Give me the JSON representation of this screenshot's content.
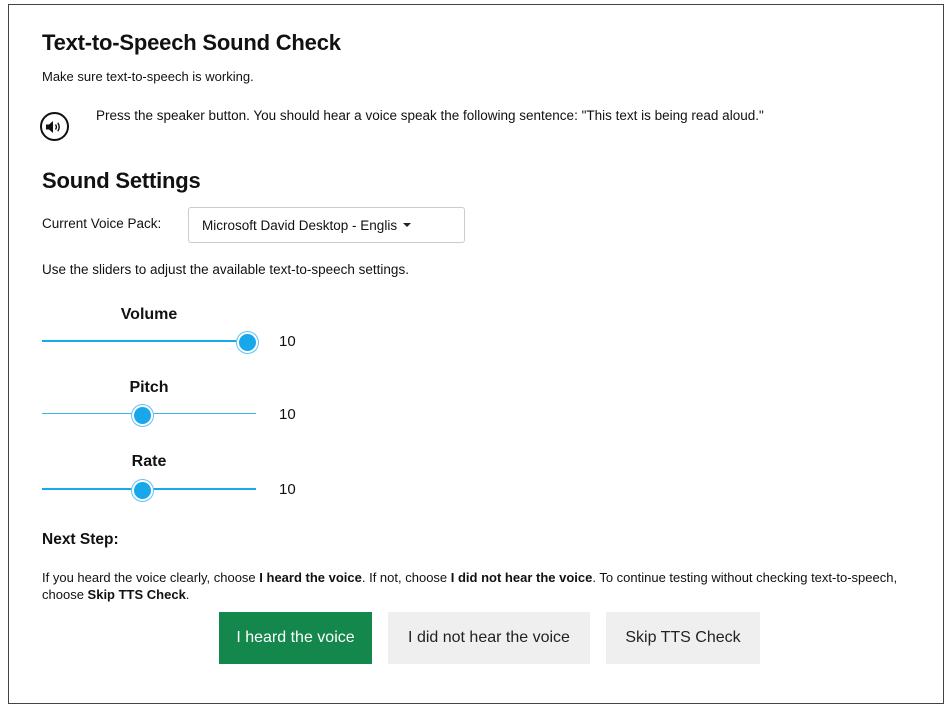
{
  "header": {
    "title": "Text-to-Speech Sound Check",
    "subtitle": "Make sure text-to-speech is working."
  },
  "speaker": {
    "icon": "speaker-volume-icon",
    "instruction": "Press the speaker button. You should hear a voice speak the following sentence: \"This text is being read aloud.\""
  },
  "settings": {
    "title": "Sound Settings",
    "voice_pack_label": "Current Voice Pack:",
    "voice_pack_value": "Microsoft David Desktop - Englis",
    "slider_instructions": "Use the sliders to adjust the available text-to-speech settings.",
    "sliders": [
      {
        "label": "Volume",
        "value": "10",
        "position_fraction": 0.96
      },
      {
        "label": "Pitch",
        "value": "10",
        "position_fraction": 0.47
      },
      {
        "label": "Rate",
        "value": "10",
        "position_fraction": 0.47
      }
    ]
  },
  "next_step": {
    "title": "Next Step:",
    "text_1": "If you heard the voice clearly, choose ",
    "bold_1": "I heard the voice",
    "text_2": ". If not, choose ",
    "bold_2": "I did not hear the voice",
    "text_3": ". To continue testing without checking text-to-speech, choose ",
    "bold_3": "Skip TTS Check",
    "text_4": "."
  },
  "buttons": {
    "heard": "I heard the voice",
    "not_heard": "I did not hear the voice",
    "skip": "Skip TTS Check"
  },
  "colors": {
    "primary_button": "#13874c",
    "secondary_button": "#efefef",
    "slider_accent": "#19a7ec"
  }
}
